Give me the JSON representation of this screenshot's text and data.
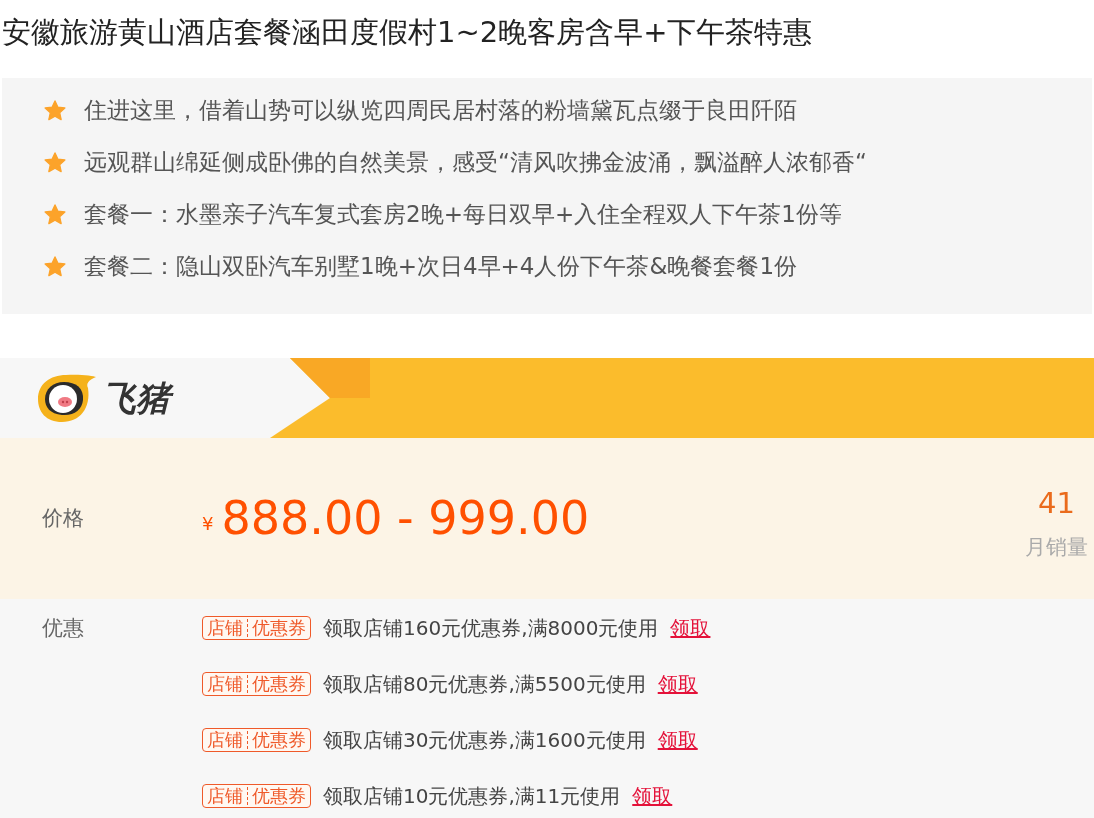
{
  "title": "安徽旅游黄山酒店套餐涵田度假村1~2晚客房含早+下午茶特惠",
  "highlights": [
    "住进这里，借着山势可以纵览四周民居村落的粉墙黛瓦点缀于良田阡陌",
    "远观群山绵延侧成卧佛的自然美景，感受“清风吹拂金波涌，飘溢醉人浓郁香“",
    "套餐一：水墨亲子汽车复式套房2晚+每日双早+入住全程双人下午茶1份等",
    "套餐二：隐山双卧汽车别墅1晚+次日4早+4人份下午茶&晚餐套餐1份"
  ],
  "brand": {
    "logo_text": "飞猪"
  },
  "price": {
    "label": "价格",
    "currency": "¥",
    "range": "888.00 - 999.00",
    "sales_count": "41",
    "sales_label": "月销量"
  },
  "coupons": {
    "label": "优惠",
    "items": [
      {
        "tag_left": "店铺",
        "tag_right": "优惠券",
        "text": "领取店铺160元优惠券,满8000元使用",
        "action": "领取"
      },
      {
        "tag_left": "店铺",
        "tag_right": "优惠券",
        "text": "领取店铺80元优惠券,满5500元使用",
        "action": "领取"
      },
      {
        "tag_left": "店铺",
        "tag_right": "优惠券",
        "text": "领取店铺30元优惠券,满1600元使用",
        "action": "领取"
      },
      {
        "tag_left": "店铺",
        "tag_right": "优惠券",
        "text": "领取店铺10元优惠券,满11元使用",
        "action": "领取"
      }
    ]
  }
}
